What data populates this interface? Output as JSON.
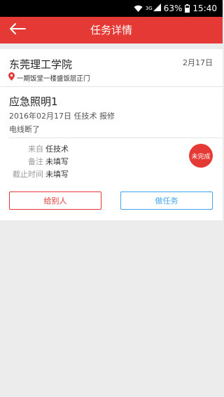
{
  "status_bar": {
    "network": "3G",
    "battery": "63%",
    "time": "15:40"
  },
  "header": {
    "title": "任务详情",
    "back_icon": "back-arrow-icon"
  },
  "task": {
    "org_name": "东莞理工学院",
    "date_short": "2月17日",
    "location": "一期饭堂一楼盛饭层正门",
    "title": "应急照明1",
    "meta": "2016年02月17日  任技术  报修",
    "description": "电线断了",
    "details": [
      {
        "label": "来自",
        "value": "任技术"
      },
      {
        "label": "备注",
        "value": "未填写"
      },
      {
        "label": "截止时间",
        "value": "未填写"
      }
    ],
    "status": "未完成"
  },
  "actions": {
    "assign_label": "给别人",
    "do_label": "做任务"
  },
  "colors": {
    "primary": "#e53935",
    "action_blue": "#42a5f5"
  }
}
